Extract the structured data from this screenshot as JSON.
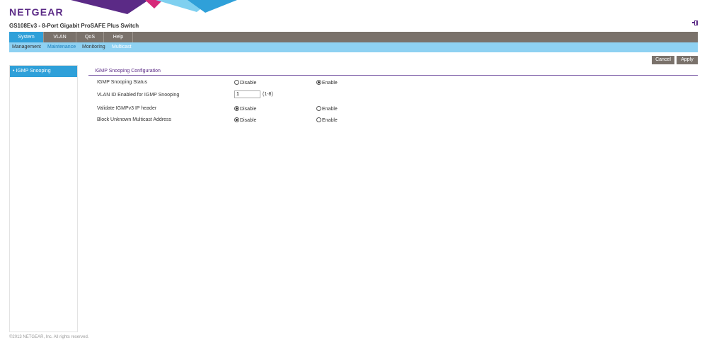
{
  "header": {
    "logo": "NETGEAR",
    "product_title": "GS108Ev3 - 8-Port Gigabit ProSAFE Plus Switch"
  },
  "main_nav": [
    {
      "label": "System",
      "active": true
    },
    {
      "label": "VLAN",
      "active": false
    },
    {
      "label": "QoS",
      "active": false
    },
    {
      "label": "Help",
      "active": false
    }
  ],
  "sub_nav": [
    {
      "label": "Management"
    },
    {
      "label": "Maintenance"
    },
    {
      "label": "Monitoring"
    },
    {
      "label": "Multicast"
    }
  ],
  "buttons": {
    "cancel": "Cancel",
    "apply": "Apply"
  },
  "sidebar": {
    "items": [
      {
        "label": "• IGMP Snooping"
      }
    ]
  },
  "config": {
    "title": "IGMP Snooping Configuration",
    "snooping_status": {
      "label": "IGMP Snooping Status",
      "option_disable": "Disable",
      "option_enable": "Enable",
      "selected": "Enable"
    },
    "vlan_id": {
      "label": "VLAN ID Enabled for IGMP Snooping",
      "value": "1",
      "hint": "(1-8)"
    },
    "validate_igmpv3": {
      "label": "Validate IGMPv3 IP header",
      "option_disable": "Disable",
      "option_enable": "Enable",
      "selected": "Disable"
    },
    "block_unknown": {
      "label": "Block Unknown Multicast Address",
      "option_disable": "Disable",
      "option_enable": "Enable",
      "selected": "Disable"
    }
  },
  "footer": "©2013 NETGEAR, Inc. All rights reserved.",
  "colors": {
    "brand": "#5b2a86",
    "accent": "#2fa0d9",
    "nav_bg": "#7a726b",
    "subnav_bg": "#8ed1f2"
  },
  "icons": {
    "logout": "logout-icon"
  }
}
